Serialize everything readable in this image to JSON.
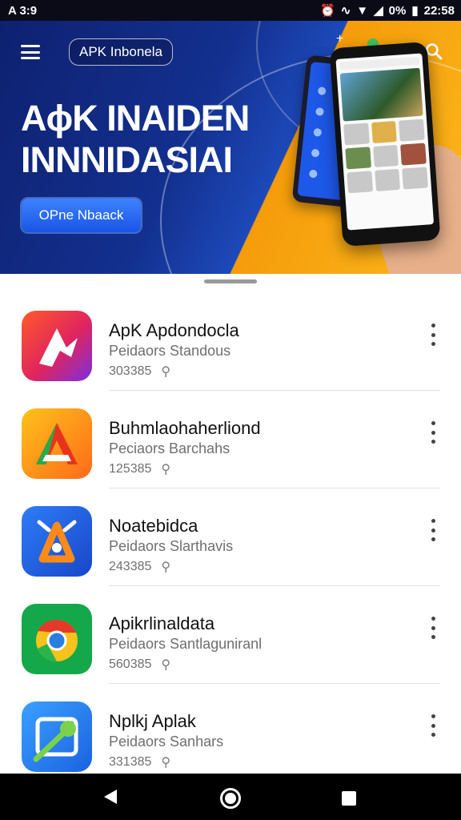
{
  "status_bar": {
    "left_text": "A 3:9",
    "battery_text": "0%",
    "time": "22:58"
  },
  "banner": {
    "site_label": "APK Inbonela",
    "title_line1": "AɸK INAIDEN",
    "title_line2": "INNNIDASIAI",
    "open_button_label": "OPne Nbaack",
    "accent_colors": [
      "#13308f",
      "#f59c0a",
      "#1a55e6"
    ]
  },
  "apps": [
    {
      "name": "ApK  Apdondocla",
      "developer": "Peidaors Standous",
      "downloads": "303385",
      "icon": "app-icon-red-purple"
    },
    {
      "name": "Buhmlaohaherliond",
      "developer": "Peciaors Barchahs",
      "downloads": "125385",
      "icon": "app-icon-orange-triangle"
    },
    {
      "name": "Noatebidca",
      "developer": "Peidaors Slarthavis",
      "downloads": "243385",
      "icon": "app-icon-blue-orange"
    },
    {
      "name": "Apikrlinaldata",
      "developer": "Peidaors Santlaguniranl",
      "downloads": "560385",
      "icon": "app-icon-green-chrome"
    },
    {
      "name": "Nplkj Aplak",
      "developer": "Peidaors Sanhars",
      "downloads": "331385",
      "icon": "app-icon-blue-android"
    }
  ]
}
